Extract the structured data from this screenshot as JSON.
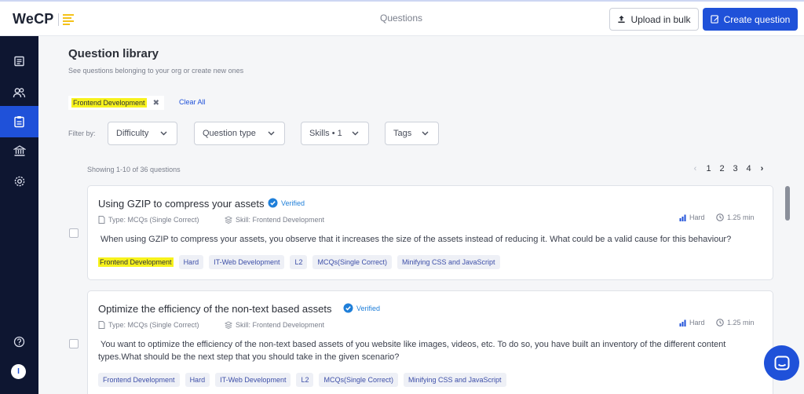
{
  "brand": {
    "name": "WeCP"
  },
  "header": {
    "title": "Questions",
    "upload_label": "Upload in bulk",
    "create_label": "Create question"
  },
  "sidebar": {
    "items": [
      "reports-icon",
      "candidates-icon",
      "questions-icon",
      "library-icon",
      "settings-icon"
    ],
    "help_icon": "help-icon",
    "avatar_initial": "I"
  },
  "library": {
    "title": "Question library",
    "subtitle": "See questions belonging to your org or create new ones",
    "active_filter": "Frontend Development",
    "clear_all": "Clear All",
    "filter_label": "Filter by:",
    "filters": [
      "Difficulty",
      "Question type",
      "Skills • 1",
      "Tags"
    ],
    "showing": "Showing 1-10 of 36 questions",
    "pages": [
      "1",
      "2",
      "3",
      "4"
    ]
  },
  "questions": [
    {
      "title": "Using GZIP to compress your assets",
      "verified": "Verified",
      "type": "Type: MCQs (Single Correct)",
      "skill": "Skill: Frontend Development",
      "difficulty": "Hard",
      "time": "1.25 min",
      "description": "When using GZIP to compress your assets, you observe that it increases the size of the assets instead of reducing it. What could be a valid cause for this behaviour?",
      "tags": [
        "Frontend Development",
        "Hard",
        "IT-Web Development",
        "L2",
        "MCQs(Single Correct)",
        "Minifying CSS and JavaScript"
      ]
    },
    {
      "title": "Optimize the efficiency of the non-text based assets",
      "verified": "Verified",
      "type": "Type: MCQs (Single Correct)",
      "skill": "Skill: Frontend Development",
      "difficulty": "Hard",
      "time": "1.25 min",
      "description_line1": "You want to optimize the efficiency of the non-text based assets of you website like images, videos, etc. To do so, you have built an inventory of the different content",
      "description_line2": "types.What should be the next step that you should take in the given scenario?",
      "tags": [
        "Frontend Development",
        "Hard",
        "IT-Web Development",
        "L2",
        "MCQs(Single Correct)",
        "Minifying CSS and JavaScript"
      ]
    }
  ],
  "colors": {
    "accent": "#1f51d9",
    "sidebar": "#0e1631",
    "highlight": "#f7f21c",
    "verified": "#1f7fd9"
  }
}
